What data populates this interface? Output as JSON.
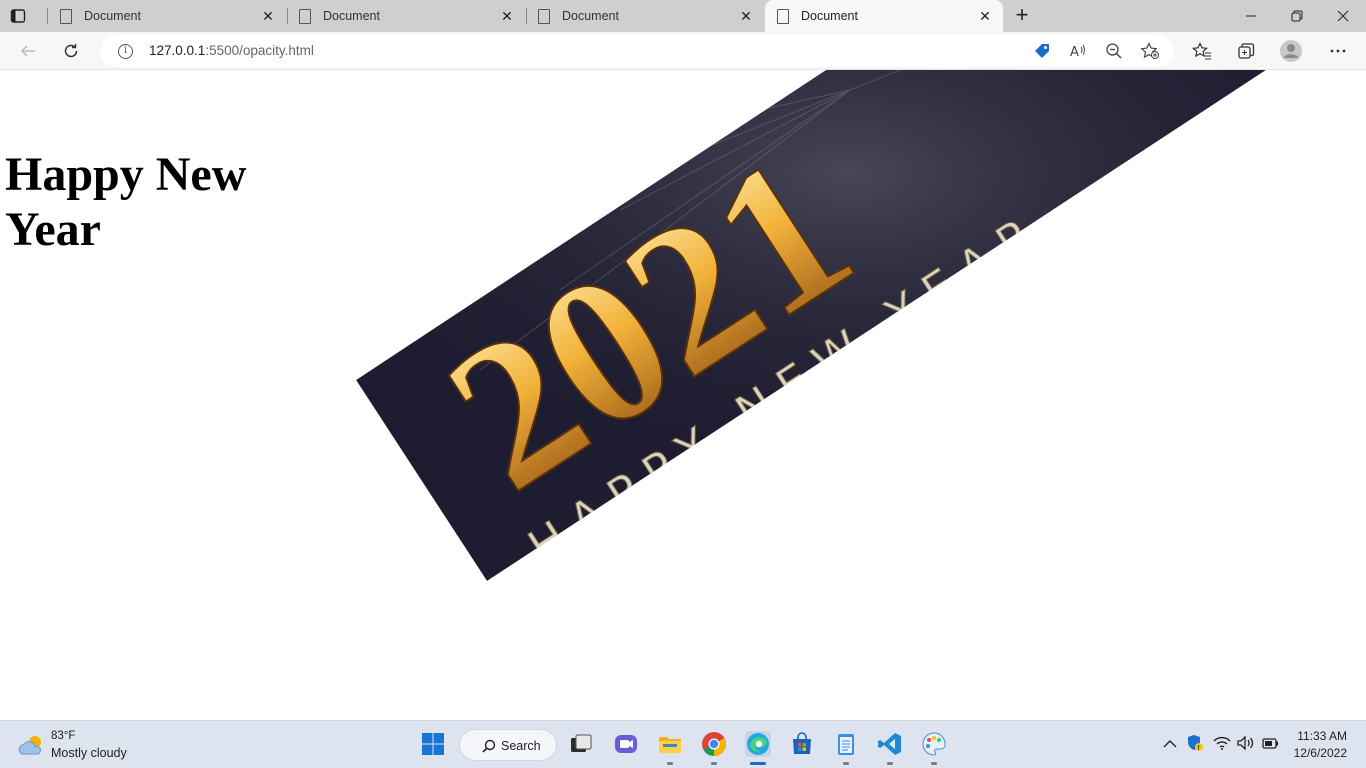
{
  "tabs": [
    {
      "title": "Document"
    },
    {
      "title": "Document"
    },
    {
      "title": "Document"
    },
    {
      "title": "Document"
    }
  ],
  "address_bar": {
    "url_host": "127.0.0.1",
    "url_rest": ":5500/opacity.html"
  },
  "page": {
    "heading": "Happy New Year",
    "banner": {
      "year_text": "2021",
      "subtitle": "HAPPY NEW YEAR",
      "rotation_deg": -33
    }
  },
  "taskbar": {
    "weather_temp": "83°F",
    "weather_desc": "Mostly cloudy",
    "search_label": "Search",
    "clock_time": "11:33 AM",
    "clock_date": "12/6/2022"
  },
  "icons": [
    "tab-actions-icon",
    "document-icon",
    "close-icon",
    "new-tab-icon",
    "minimize-icon",
    "restore-icon",
    "window-close-icon",
    "back-icon",
    "refresh-icon",
    "info-icon",
    "shopping-tag-icon",
    "read-aloud-icon",
    "zoom-out-icon",
    "add-favorite-icon",
    "favorites-icon",
    "collections-icon",
    "profile-icon",
    "more-icon",
    "weather-icon",
    "windows-start-icon",
    "search-icon",
    "task-view-icon",
    "chat-icon",
    "file-explorer-icon",
    "chrome-icon",
    "edge-icon",
    "store-icon",
    "notepad-icon",
    "vscode-icon",
    "paint-icon",
    "chevron-up-icon",
    "security-icon",
    "wifi-icon",
    "volume-icon",
    "battery-icon"
  ]
}
